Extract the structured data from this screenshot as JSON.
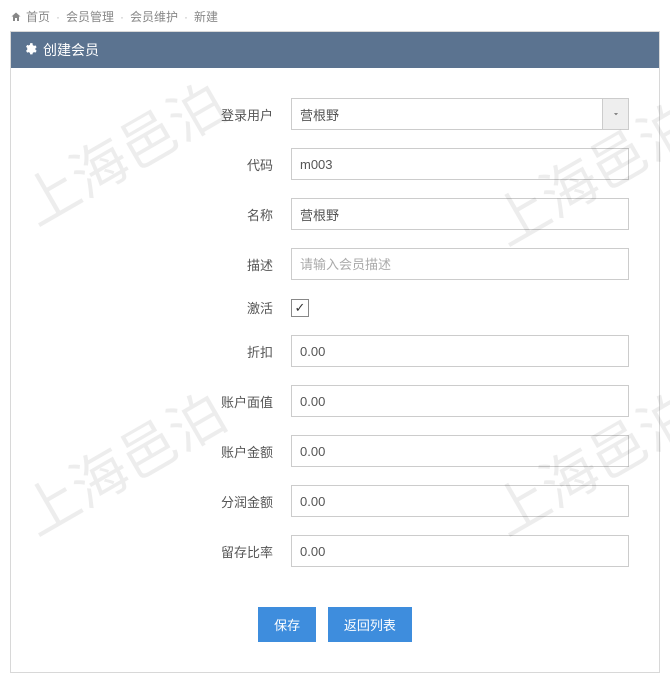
{
  "breadcrumb": {
    "home": "首页",
    "level1": "会员管理",
    "level2": "会员维护",
    "current": "新建"
  },
  "panel": {
    "title": "创建会员"
  },
  "form": {
    "labels": {
      "login_user": "登录用户",
      "code": "代码",
      "name": "名称",
      "description": "描述",
      "active": "激活",
      "discount": "折扣",
      "account_face_value": "账户面值",
      "account_amount": "账户金额",
      "profit_share_amount": "分润金额",
      "retain_ratio": "留存比率"
    },
    "values": {
      "login_user": "营根野",
      "code": "m003",
      "name": "营根野",
      "description": "",
      "active_checked": true,
      "discount": "0.00",
      "account_face_value": "0.00",
      "account_amount": "0.00",
      "profit_share_amount": "0.00",
      "retain_ratio": "0.00"
    },
    "placeholders": {
      "description": "请输入会员描述"
    }
  },
  "actions": {
    "save": "保存",
    "back_to_list": "返回列表"
  },
  "watermark_text": "上海邑泊"
}
